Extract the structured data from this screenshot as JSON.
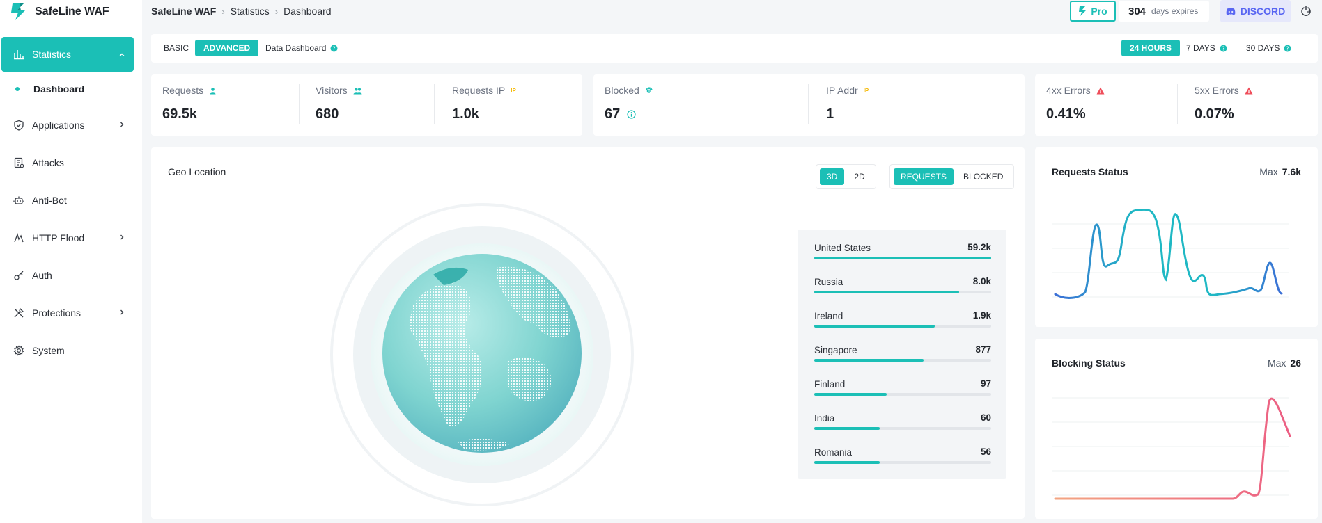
{
  "brand": {
    "name": "SafeLine WAF"
  },
  "breadcrumb": [
    "SafeLine WAF",
    "Statistics",
    "Dashboard"
  ],
  "header": {
    "pro_label": "Pro",
    "days": "304",
    "days_label": "days expires",
    "discord_label": "DISCORD"
  },
  "sidebar": {
    "items": [
      {
        "label": "Statistics",
        "icon": "bar-chart-icon",
        "active": true
      },
      {
        "label": "Dashboard",
        "sub": true
      },
      {
        "label": "Applications",
        "icon": "shield-icon",
        "chevron": true
      },
      {
        "label": "Attacks",
        "icon": "document-icon"
      },
      {
        "label": "Anti-Bot",
        "icon": "robot-icon"
      },
      {
        "label": "HTTP Flood",
        "icon": "flood-icon",
        "chevron": true
      },
      {
        "label": "Auth",
        "icon": "key-icon"
      },
      {
        "label": "Protections",
        "icon": "tools-icon",
        "chevron": true
      },
      {
        "label": "System",
        "icon": "gear-icon"
      }
    ]
  },
  "tabs": {
    "basic": "BASIC",
    "advanced": "ADVANCED",
    "data_dashboard": "Data Dashboard",
    "h24": "24 HOURS",
    "d7": "7 DAYS",
    "d30": "30 DAYS"
  },
  "metrics": {
    "requests": {
      "label": "Requests",
      "value": "69.5k"
    },
    "visitors": {
      "label": "Visitors",
      "value": "680"
    },
    "requests_ip": {
      "label": "Requests IP",
      "value": "1.0k",
      "tag": "IP"
    },
    "blocked": {
      "label": "Blocked",
      "value": "67"
    },
    "ip_addr": {
      "label": "IP Addr",
      "value": "1",
      "tag": "IP"
    },
    "errors_4xx": {
      "label": "4xx Errors",
      "value": "0.41%"
    },
    "errors_5xx": {
      "label": "5xx Errors",
      "value": "0.07%"
    }
  },
  "geo": {
    "title": "Geo Location",
    "view_3d": "3D",
    "view_2d": "2D",
    "mode_requests": "REQUESTS",
    "mode_blocked": "BLOCKED",
    "countries": [
      {
        "name": "United States",
        "value": "59.2k",
        "fraction": 1.0
      },
      {
        "name": "Russia",
        "value": "8.0k",
        "fraction": 0.82
      },
      {
        "name": "Ireland",
        "value": "1.9k",
        "fraction": 0.68
      },
      {
        "name": "Singapore",
        "value": "877",
        "fraction": 0.62
      },
      {
        "name": "Finland",
        "value": "97",
        "fraction": 0.41
      },
      {
        "name": "India",
        "value": "60",
        "fraction": 0.37
      },
      {
        "name": "Romania",
        "value": "56",
        "fraction": 0.37
      }
    ]
  },
  "requests_status": {
    "title": "Requests Status",
    "max_label": "Max",
    "max_value": "7.6k"
  },
  "blocking_status": {
    "title": "Blocking Status",
    "max_label": "Max",
    "max_value": "26"
  },
  "colors": {
    "accent": "#1bbfb6",
    "line_blue": "#3b6fd6",
    "line_red": "#ef6f7f"
  }
}
